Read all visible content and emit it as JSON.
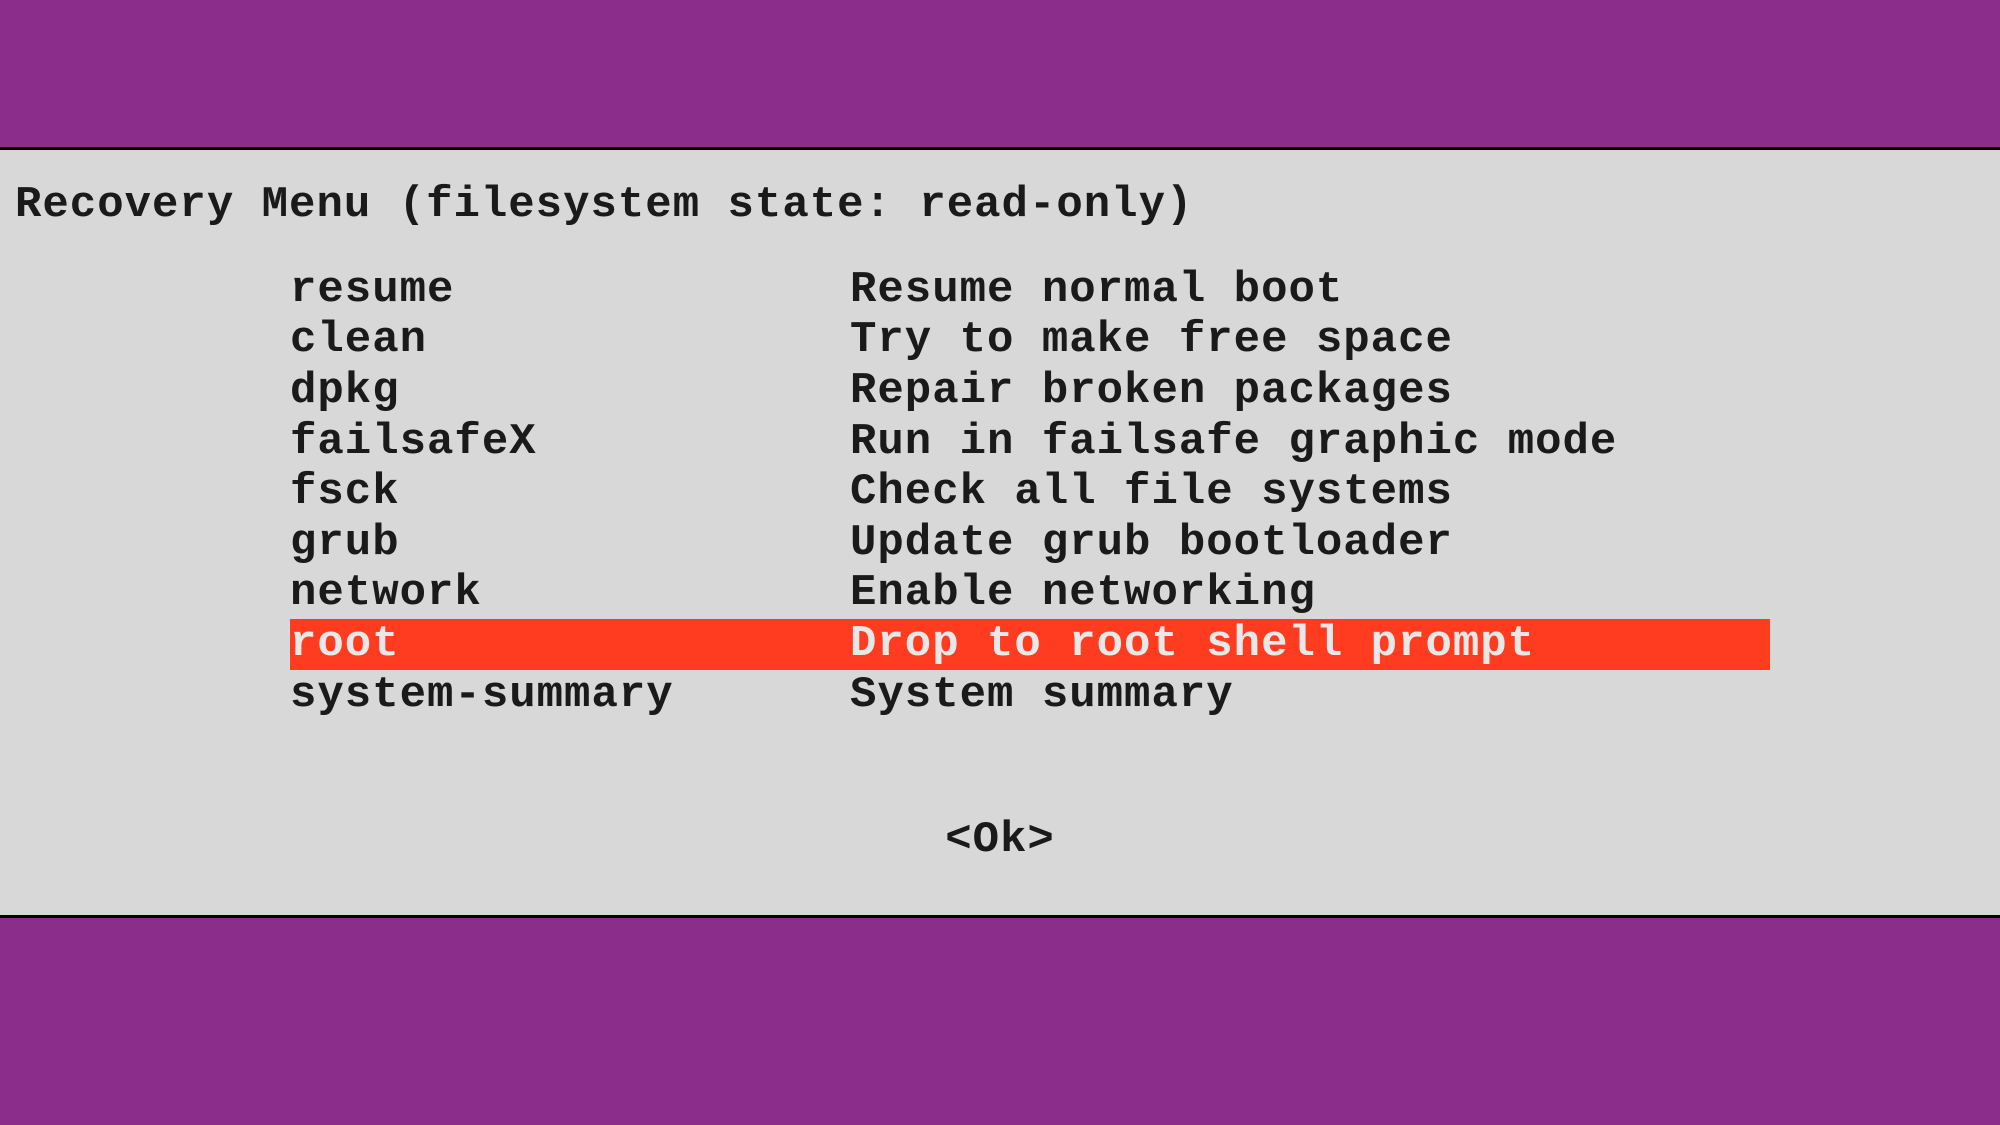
{
  "title": "Recovery Menu (filesystem state: read-only)",
  "menu": {
    "items": [
      {
        "key": "resume",
        "desc": "Resume normal boot",
        "selected": false
      },
      {
        "key": "clean",
        "desc": "Try to make free space",
        "selected": false
      },
      {
        "key": "dpkg",
        "desc": "Repair broken packages",
        "selected": false
      },
      {
        "key": "failsafeX",
        "desc": "Run in failsafe graphic mode",
        "selected": false
      },
      {
        "key": "fsck",
        "desc": "Check all file systems",
        "selected": false
      },
      {
        "key": "grub",
        "desc": "Update grub bootloader",
        "selected": false
      },
      {
        "key": "network",
        "desc": "Enable networking",
        "selected": false
      },
      {
        "key": "root",
        "desc": "Drop to root shell prompt",
        "selected": true
      },
      {
        "key": "system-summary",
        "desc": "System summary",
        "selected": false
      }
    ]
  },
  "ok_label": "<Ok>"
}
